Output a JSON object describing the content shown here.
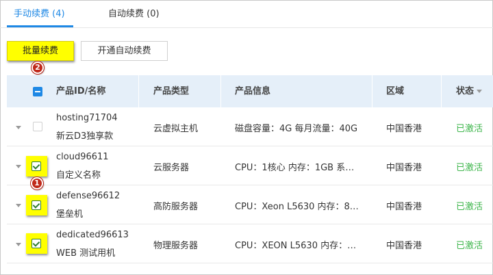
{
  "tabs": {
    "manual": "手动续费 (4)",
    "auto": "自动续费 (0)"
  },
  "toolbar": {
    "batch_renew": "批量续费",
    "enable_auto_renew": "开通自动续费"
  },
  "annotations": {
    "badge_1": "1",
    "badge_2": "2"
  },
  "table": {
    "headers": {
      "product": "产品ID/名称",
      "type": "产品类型",
      "info": "产品信息",
      "region": "区域",
      "status": "状态"
    },
    "rows": [
      {
        "id": "hosting71704",
        "name": "新云D3独享款",
        "type": "云虚拟主机",
        "info": "磁盘容量：4G 每月流量：40G",
        "region": "中国香港",
        "status": "已激活",
        "checked": false
      },
      {
        "id": "cloud96611",
        "name": "自定义名称",
        "type": "云服务器",
        "info": "CPU：1核心 内存：1GB 系…",
        "region": "中国香港",
        "status": "已激活",
        "checked": true
      },
      {
        "id": "defense96612",
        "name": "堡垒机",
        "type": "高防服务器",
        "info": "CPU：Xeon L5630 内存：8…",
        "region": "中国香港",
        "status": "已激活",
        "checked": true
      },
      {
        "id": "dedicated96613",
        "name": "WEB 测试用机",
        "type": "物理服务器",
        "info": "CPU：XEON L5630 内存：…",
        "region": "中国香港",
        "status": "已激活",
        "checked": true
      }
    ]
  },
  "colors": {
    "accent": "#1e88e5",
    "highlight": "#ffff00",
    "status_active": "#3cb54a",
    "badge": "#c0291a",
    "header_bg": "#e5eff9"
  }
}
